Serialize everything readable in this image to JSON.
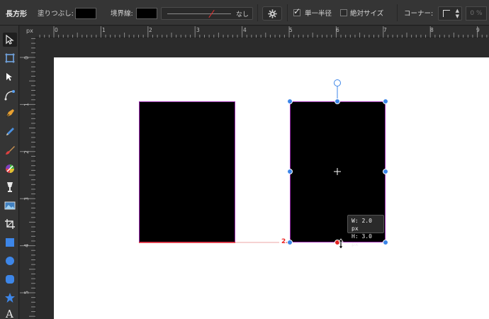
{
  "toolbar": {
    "tool_name": "長方形",
    "fill_label": "塗りつぶし:",
    "stroke_label": "境界線:",
    "stroke_value": "なし",
    "single_radius_label": "単一半径",
    "absolute_size_label": "絶対サイズ",
    "corner_label": "コーナー:",
    "corner_percent": "0 %",
    "single_radius_checked": true,
    "absolute_size_checked": false
  },
  "ruler": {
    "unit": "px",
    "h_labels": [
      "0",
      "1",
      "2",
      "3",
      "4",
      "5",
      "6",
      "7",
      "8",
      "9"
    ],
    "v_labels": [
      "0",
      "1",
      "2",
      "3",
      "4",
      "5"
    ]
  },
  "tooltip": {
    "width": "W: 2.0 px",
    "height": "H: 3.0 px"
  },
  "snap_label": "2.",
  "colors": {
    "selection": "#3d86e8",
    "shape_fill": "#000000",
    "shape_outline": "#9c2bb0",
    "snap_guide": "#e22222"
  },
  "tools": [
    "move-tool-icon",
    "artboard-tool-icon",
    "node-tool-icon",
    "corner-tool-icon",
    "pen-tool-icon",
    "pencil-tool-icon",
    "brush-tool-icon",
    "fill-tool-icon",
    "transparency-tool-icon",
    "place-image-tool-icon",
    "crop-tool-icon",
    "rectangle-tool-icon",
    "ellipse-tool-icon",
    "rounded-rectangle-tool-icon",
    "star-tool-icon",
    "text-tool-icon"
  ]
}
